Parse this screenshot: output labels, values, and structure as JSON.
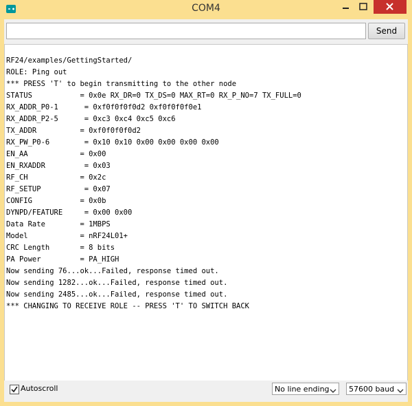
{
  "window": {
    "title": "COM4"
  },
  "toolbar": {
    "send_label": "Send",
    "input_value": ""
  },
  "console": {
    "lines": [
      "RF24/examples/GettingStarted/",
      "ROLE: Ping out",
      "*** PRESS 'T' to begin transmitting to the other node",
      "STATUS           = 0x0e RX_DR=0 TX_DS=0 MAX_RT=0 RX_P_NO=7 TX_FULL=0",
      "RX_ADDR_P0-1      = 0xf0f0f0f0d2 0xf0f0f0f0e1",
      "RX_ADDR_P2-5      = 0xc3 0xc4 0xc5 0xc6",
      "TX_ADDR          = 0xf0f0f0f0d2",
      "RX_PW_P0-6        = 0x10 0x10 0x00 0x00 0x00 0x00",
      "EN_AA            = 0x00",
      "EN_RXADDR         = 0x03",
      "RF_CH            = 0x2c",
      "RF_SETUP          = 0x07",
      "CONFIG           = 0x0b",
      "DYNPD/FEATURE     = 0x00 0x00",
      "Data Rate        = 1MBPS",
      "Model            = nRF24L01+",
      "CRC Length       = 8 bits",
      "PA Power         = PA_HIGH",
      "Now sending 76...ok...Failed, response timed out.",
      "Now sending 1282...ok...Failed, response timed out.",
      "Now sending 2485...ok...Failed, response timed out.",
      "*** CHANGING TO RECEIVE ROLE -- PRESS 'T' TO SWITCH BACK"
    ]
  },
  "statusbar": {
    "autoscroll_label": "Autoscroll",
    "autoscroll_checked": true,
    "line_ending": "No line ending",
    "baud": "57600 baud"
  },
  "icons": {
    "app": "arduino-icon",
    "minimize": "minimize-icon",
    "maximize": "maximize-icon",
    "close": "close-icon",
    "chevron": "chevron-down-icon",
    "check": "check-icon"
  }
}
